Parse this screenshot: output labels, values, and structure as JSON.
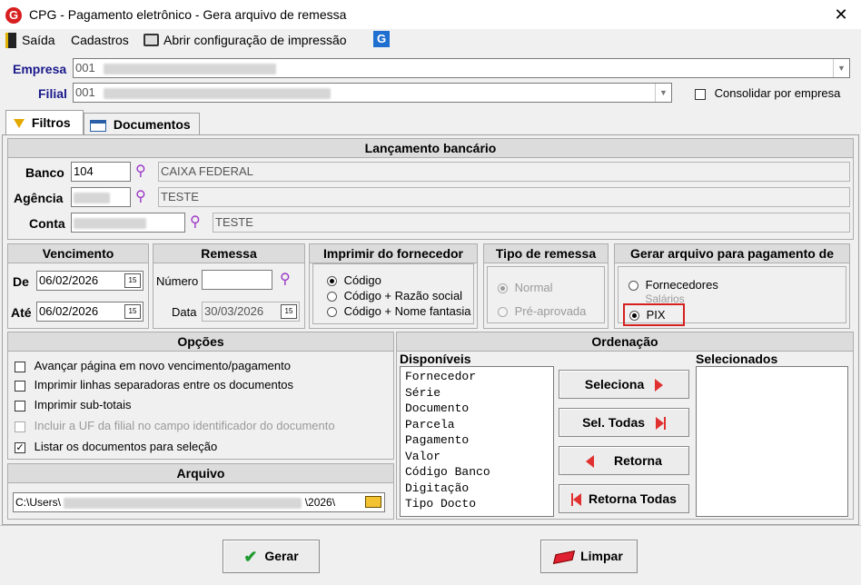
{
  "window": {
    "title": "CPG - Pagamento eletrônico - Gera arquivo de remessa",
    "close": "✕"
  },
  "menu": {
    "saida": "Saída",
    "cadastros": "Cadastros",
    "config": "Abrir configuração de impressão"
  },
  "empresa": {
    "label": "Empresa",
    "value": "001"
  },
  "filial": {
    "label": "Filial",
    "value": "001",
    "consolidar_label": "Consolidar por empresa",
    "consolidar_checked": false
  },
  "tabs": [
    {
      "label": "Filtros"
    },
    {
      "label": "Documentos"
    }
  ],
  "lancamento": {
    "header": "Lançamento bancário",
    "banco_label": "Banco",
    "banco_value": "104",
    "banco_name": "CAIXA FEDERAL",
    "agencia_label": "Agência",
    "agencia_name": "TESTE",
    "conta_label": "Conta",
    "conta_name": "TESTE"
  },
  "vencimento": {
    "header": "Vencimento",
    "de_label": "De",
    "de_value": "06/02/2026",
    "ate_label": "Até",
    "ate_value": "06/02/2026"
  },
  "remessa": {
    "header": "Remessa",
    "numero_label": "Número",
    "numero_value": "",
    "data_label": "Data",
    "data_value": "30/03/2026"
  },
  "imprimir_fornecedor": {
    "header": "Imprimir do fornecedor",
    "options": [
      "Código",
      "Código + Razão social",
      "Código + Nome fantasia"
    ],
    "selected": 0
  },
  "tipo_remessa": {
    "header": "Tipo de remessa",
    "options": [
      "Normal",
      "Pré-aprovada"
    ],
    "selected": 0
  },
  "gerar_arquivo": {
    "header": "Gerar arquivo para pagamento de",
    "options": [
      "Fornecedores",
      "Salários",
      "PIX"
    ],
    "selected": 2,
    "highlight_color": "#d62020"
  },
  "opcoes": {
    "header": "Opções",
    "items": [
      {
        "label": "Avançar página em novo vencimento/pagamento",
        "checked": false,
        "disabled": false
      },
      {
        "label": "Imprimir linhas separadoras entre os documentos",
        "checked": false,
        "disabled": false
      },
      {
        "label": "Imprimir sub-totais",
        "checked": false,
        "disabled": false
      },
      {
        "label": "Incluir a UF da filial no campo identificador do documento",
        "checked": false,
        "disabled": true
      },
      {
        "label": "Listar os documentos para seleção",
        "checked": true,
        "disabled": false
      }
    ]
  },
  "arquivo": {
    "header": "Arquivo",
    "path_start": "C:\\Users\\",
    "path_end": "\\2026\\"
  },
  "ordenacao": {
    "header": "Ordenação",
    "disponiveis_label": "Disponíveis",
    "selecionados_label": "Selecionados",
    "disponiveis": [
      "Fornecedor",
      "Série",
      "Documento",
      "Parcela",
      "Pagamento",
      "Valor",
      "Código Banco",
      "Digitação",
      "Tipo Docto"
    ],
    "selecionados": [],
    "btn_seleciona": "Seleciona",
    "btn_sel_todas": "Sel. Todas",
    "btn_retorna": "Retorna",
    "btn_retorna_todas": "Retorna Todas"
  },
  "footer": {
    "gerar": "Gerar",
    "limpar": "Limpar"
  }
}
